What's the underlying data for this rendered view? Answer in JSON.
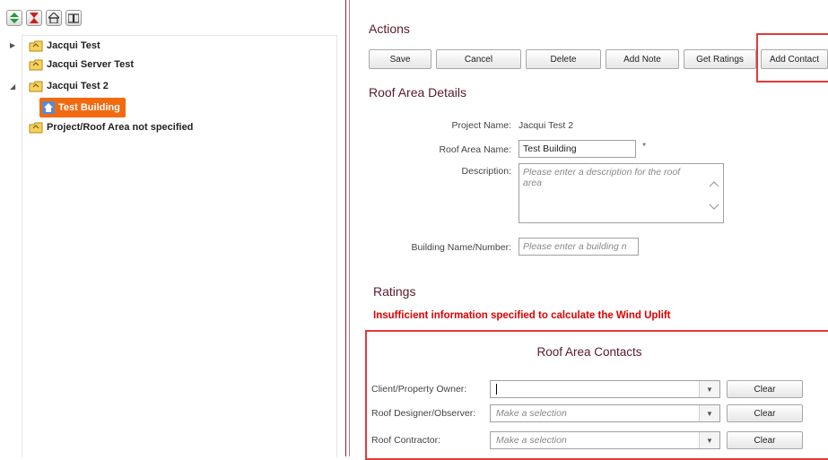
{
  "toolbar": {
    "icons": [
      "expand-collapse-icon",
      "hourglass-icon",
      "home-icon",
      "book-icon"
    ]
  },
  "tree": {
    "items": [
      {
        "label": "Jacqui Test",
        "expander": "▶"
      },
      {
        "label": "Jacqui Server Test"
      },
      {
        "label": "Jacqui Test 2",
        "expander": "◢"
      },
      {
        "label": "Test Building",
        "selected": true
      },
      {
        "label": "Project/Roof Area not specified"
      }
    ]
  },
  "actions": {
    "title": "Actions",
    "buttons": [
      "Save",
      "Cancel",
      "Delete",
      "Add Note",
      "Get Ratings",
      "Add Contact"
    ]
  },
  "details": {
    "title": "Roof Area Details",
    "project_label": "Project Name:",
    "project_value": "Jacqui Test 2",
    "roof_label": "Roof Area Name:",
    "roof_value": "Test Building",
    "required_mark": "*",
    "desc_label": "Description:",
    "desc_placeholder": "Please enter a description for the roof area",
    "building_label": "Building Name/Number:",
    "building_placeholder": "Please enter a building n"
  },
  "ratings": {
    "title": "Ratings",
    "warning": "Insufficient information specified to calculate the Wind Uplift"
  },
  "contacts": {
    "title": "Roof Area Contacts",
    "rows": [
      {
        "label": "Client/Property Owner:",
        "value": "",
        "clear": "Clear"
      },
      {
        "label": "Roof Designer/Observer:",
        "value": "Make a selection",
        "clear": "Clear"
      },
      {
        "label": "Roof Contractor:",
        "value": "Make a selection",
        "clear": "Clear"
      }
    ]
  },
  "colors": {
    "accent": "#f26a10",
    "heading": "#5a1a2a",
    "warning": "#e00000",
    "highlight_box": "#e23a3a"
  }
}
